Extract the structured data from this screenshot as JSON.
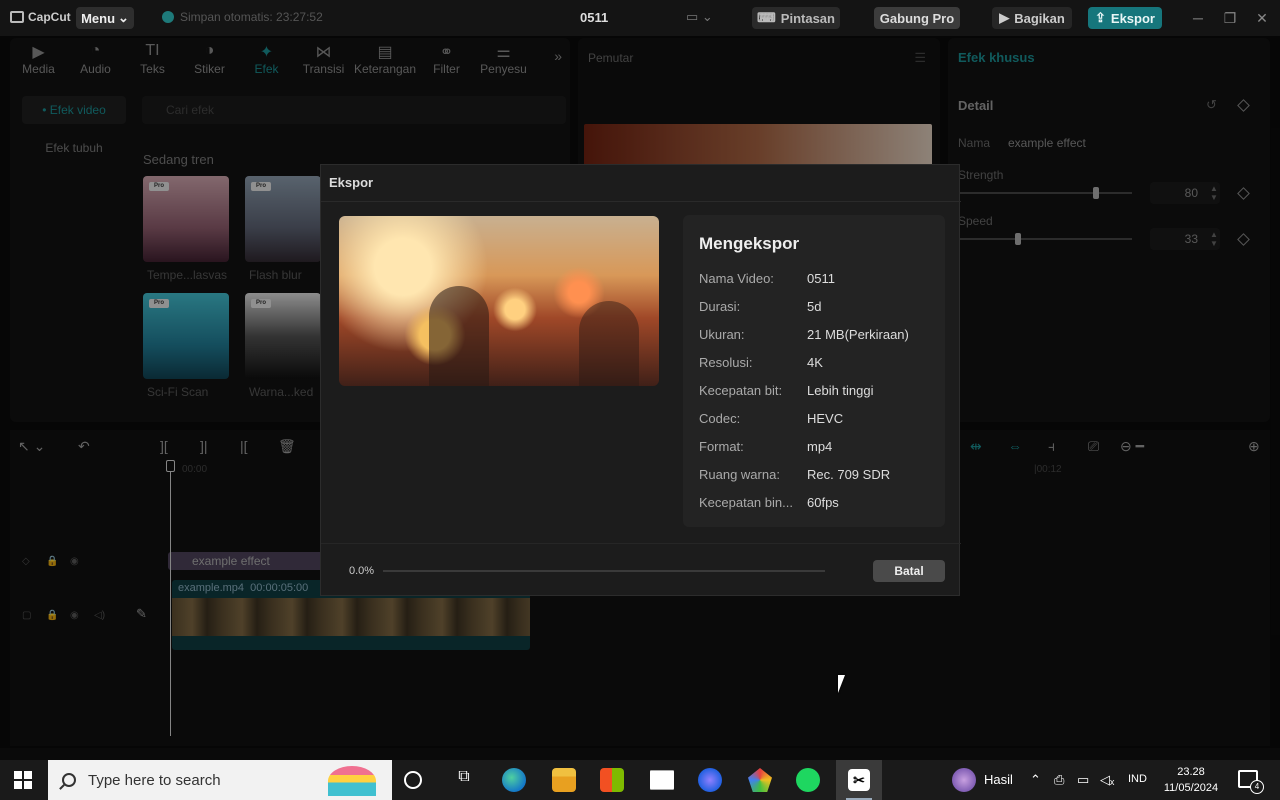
{
  "app": {
    "logo": "CapCut",
    "menu_label": "Menu",
    "autosave": "Simpan otomatis: 23:27:52",
    "project_title": "0511",
    "shortcut_label": "Pintasan",
    "pro_label": "Gabung Pro",
    "share_label": "Bagikan",
    "export_label": "Ekspor"
  },
  "tabs": [
    {
      "label": "Media",
      "icon": "media-icon"
    },
    {
      "label": "Audio",
      "icon": "audio-icon"
    },
    {
      "label": "Teks",
      "icon": "text-icon"
    },
    {
      "label": "Stiker",
      "icon": "sticker-icon"
    },
    {
      "label": "Efek",
      "icon": "effects-icon"
    },
    {
      "label": "Transisi",
      "icon": "transition-icon"
    },
    {
      "label": "Keterangan",
      "icon": "captions-icon"
    },
    {
      "label": "Filter",
      "icon": "filter-icon"
    },
    {
      "label": "Penyesu",
      "icon": "adjust-icon"
    }
  ],
  "left_sidebar": {
    "items": [
      {
        "label": "• Efek video"
      },
      {
        "label": "Efek tubuh"
      }
    ],
    "search_placeholder": "Cari efek",
    "trending_title": "Sedang tren",
    "thumbnails": [
      {
        "label": "Tempe...lasvas",
        "badge": "Pro"
      },
      {
        "label": "Flash blur",
        "badge": "Pro"
      },
      {
        "label": "Sci-Fi Scan",
        "badge": "Pro"
      },
      {
        "label": "Warna...ked",
        "badge": "Pro"
      }
    ]
  },
  "player": {
    "title": "Pemutar"
  },
  "right_panel": {
    "title": "Efek khusus",
    "detail_label": "Detail",
    "name_label": "Nama",
    "name_value": "example effect",
    "strength_label": "Strength",
    "strength_value": "80",
    "speed_label": "Speed",
    "speed_value": "33"
  },
  "timeline": {
    "time_start": "00:00",
    "time_marker": "|00:12",
    "effect_clip": "example effect",
    "video_clip_name": "example.mp4",
    "video_clip_duration": "00:00:05:00"
  },
  "export_dialog": {
    "title": "Ekspor",
    "heading": "Mengekspor",
    "rows": [
      {
        "key": "Nama Video:",
        "value": "0511"
      },
      {
        "key": "Durasi:",
        "value": "5d"
      },
      {
        "key": "Ukuran:",
        "value": "21 MB(Perkiraan)"
      },
      {
        "key": "Resolusi:",
        "value": "4K"
      },
      {
        "key": "Kecepatan bit:",
        "value": "Lebih tinggi"
      },
      {
        "key": "Codec:",
        "value": "HEVC"
      },
      {
        "key": "Format:",
        "value": "mp4"
      },
      {
        "key": "Ruang warna:",
        "value": "Rec. 709 SDR"
      },
      {
        "key": "Kecepatan bin...",
        "value": "60fps"
      }
    ],
    "progress_text": "0.0%",
    "progress_fraction": 0.0,
    "cancel_label": "Batal"
  },
  "taskbar": {
    "search_placeholder": "Type here to search",
    "weather_label": "Hasil",
    "language": "IND",
    "time": "23.28",
    "date": "11/05/2024",
    "notification_count": "4"
  },
  "colors": {
    "accent": "#1a8a8e",
    "export_button": "#16767c",
    "effect_clip": "#4a3f56",
    "video_clip": "#0e3a3e"
  }
}
